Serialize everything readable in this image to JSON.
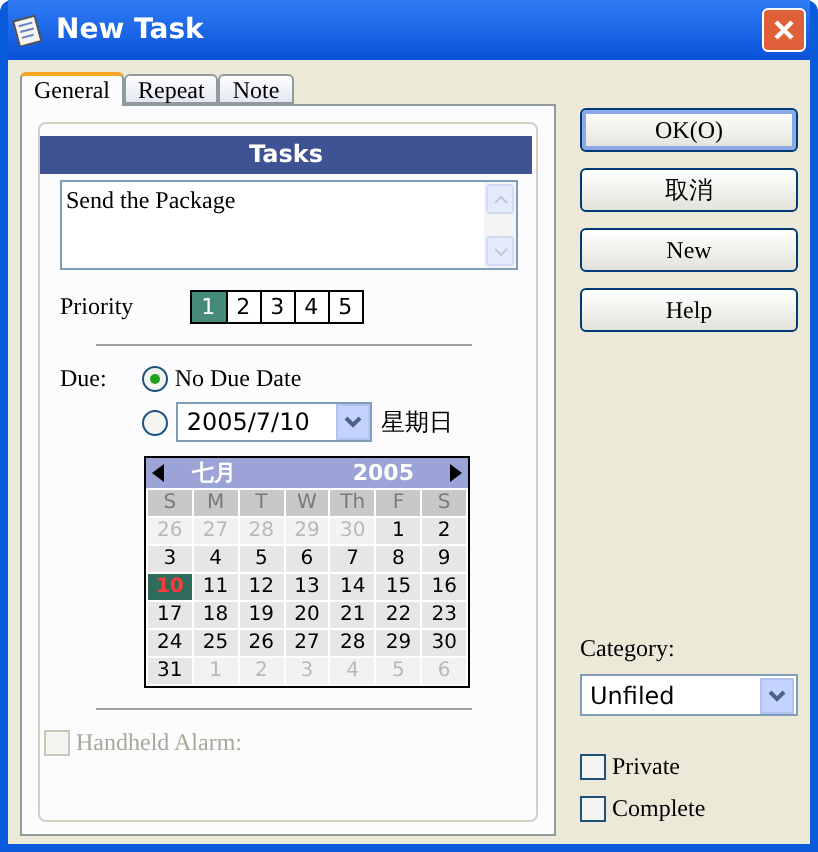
{
  "window": {
    "title": "New Task"
  },
  "tabs": [
    {
      "label": "General",
      "selected": true
    },
    {
      "label": "Repeat",
      "selected": false
    },
    {
      "label": "Note",
      "selected": false
    }
  ],
  "tasks_header": "Tasks",
  "description": {
    "value": "Send the Package"
  },
  "priority": {
    "label": "Priority",
    "options": [
      {
        "label": "1",
        "selected": true
      },
      {
        "label": "2",
        "selected": false
      },
      {
        "label": "3",
        "selected": false
      },
      {
        "label": "4",
        "selected": false
      },
      {
        "label": "5",
        "selected": false
      }
    ]
  },
  "due": {
    "label": "Due:",
    "options": [
      {
        "label": "No Due Date",
        "selected": true
      },
      {
        "selected": false
      }
    ],
    "date": "2005/7/10",
    "weekday": "星期日"
  },
  "calendar": {
    "month": "七月",
    "year": "2005",
    "weekdays": [
      "S",
      "M",
      "T",
      "W",
      "Th",
      "F",
      "S"
    ],
    "weeks": [
      [
        {
          "day": "26",
          "in_month": false,
          "selected": false
        },
        {
          "day": "27",
          "in_month": false,
          "selected": false
        },
        {
          "day": "28",
          "in_month": false,
          "selected": false
        },
        {
          "day": "29",
          "in_month": false,
          "selected": false
        },
        {
          "day": "30",
          "in_month": false,
          "selected": false
        },
        {
          "day": "1",
          "in_month": true,
          "selected": false
        },
        {
          "day": "2",
          "in_month": true,
          "selected": false
        }
      ],
      [
        {
          "day": "3",
          "in_month": true,
          "selected": false
        },
        {
          "day": "4",
          "in_month": true,
          "selected": false
        },
        {
          "day": "5",
          "in_month": true,
          "selected": false
        },
        {
          "day": "6",
          "in_month": true,
          "selected": false
        },
        {
          "day": "7",
          "in_month": true,
          "selected": false
        },
        {
          "day": "8",
          "in_month": true,
          "selected": false
        },
        {
          "day": "9",
          "in_month": true,
          "selected": false
        }
      ],
      [
        {
          "day": "10",
          "in_month": true,
          "selected": true
        },
        {
          "day": "11",
          "in_month": true,
          "selected": false
        },
        {
          "day": "12",
          "in_month": true,
          "selected": false
        },
        {
          "day": "13",
          "in_month": true,
          "selected": false
        },
        {
          "day": "14",
          "in_month": true,
          "selected": false
        },
        {
          "day": "15",
          "in_month": true,
          "selected": false
        },
        {
          "day": "16",
          "in_month": true,
          "selected": false
        }
      ],
      [
        {
          "day": "17",
          "in_month": true,
          "selected": false
        },
        {
          "day": "18",
          "in_month": true,
          "selected": false
        },
        {
          "day": "19",
          "in_month": true,
          "selected": false
        },
        {
          "day": "20",
          "in_month": true,
          "selected": false
        },
        {
          "day": "21",
          "in_month": true,
          "selected": false
        },
        {
          "day": "22",
          "in_month": true,
          "selected": false
        },
        {
          "day": "23",
          "in_month": true,
          "selected": false
        }
      ],
      [
        {
          "day": "24",
          "in_month": true,
          "selected": false
        },
        {
          "day": "25",
          "in_month": true,
          "selected": false
        },
        {
          "day": "26",
          "in_month": true,
          "selected": false
        },
        {
          "day": "27",
          "in_month": true,
          "selected": false
        },
        {
          "day": "28",
          "in_month": true,
          "selected": false
        },
        {
          "day": "29",
          "in_month": true,
          "selected": false
        },
        {
          "day": "30",
          "in_month": true,
          "selected": false
        }
      ],
      [
        {
          "day": "31",
          "in_month": true,
          "selected": false
        },
        {
          "day": "1",
          "in_month": false,
          "selected": false
        },
        {
          "day": "2",
          "in_month": false,
          "selected": false
        },
        {
          "day": "3",
          "in_month": false,
          "selected": false
        },
        {
          "day": "4",
          "in_month": false,
          "selected": false
        },
        {
          "day": "5",
          "in_month": false,
          "selected": false
        },
        {
          "day": "6",
          "in_month": false,
          "selected": false
        }
      ]
    ]
  },
  "handheld_alarm": {
    "label": "Handheld Alarm:",
    "checked": false,
    "disabled": true
  },
  "buttons": [
    {
      "label": "OK(O)",
      "default": true
    },
    {
      "label": "取消",
      "default": false
    },
    {
      "label": "New",
      "default": false
    },
    {
      "label": "Help",
      "default": false
    }
  ],
  "category": {
    "label": "Category:",
    "value": "Unfiled"
  },
  "checkboxes": [
    {
      "label": "Private",
      "checked": false
    },
    {
      "label": "Complete",
      "checked": false
    }
  ]
}
